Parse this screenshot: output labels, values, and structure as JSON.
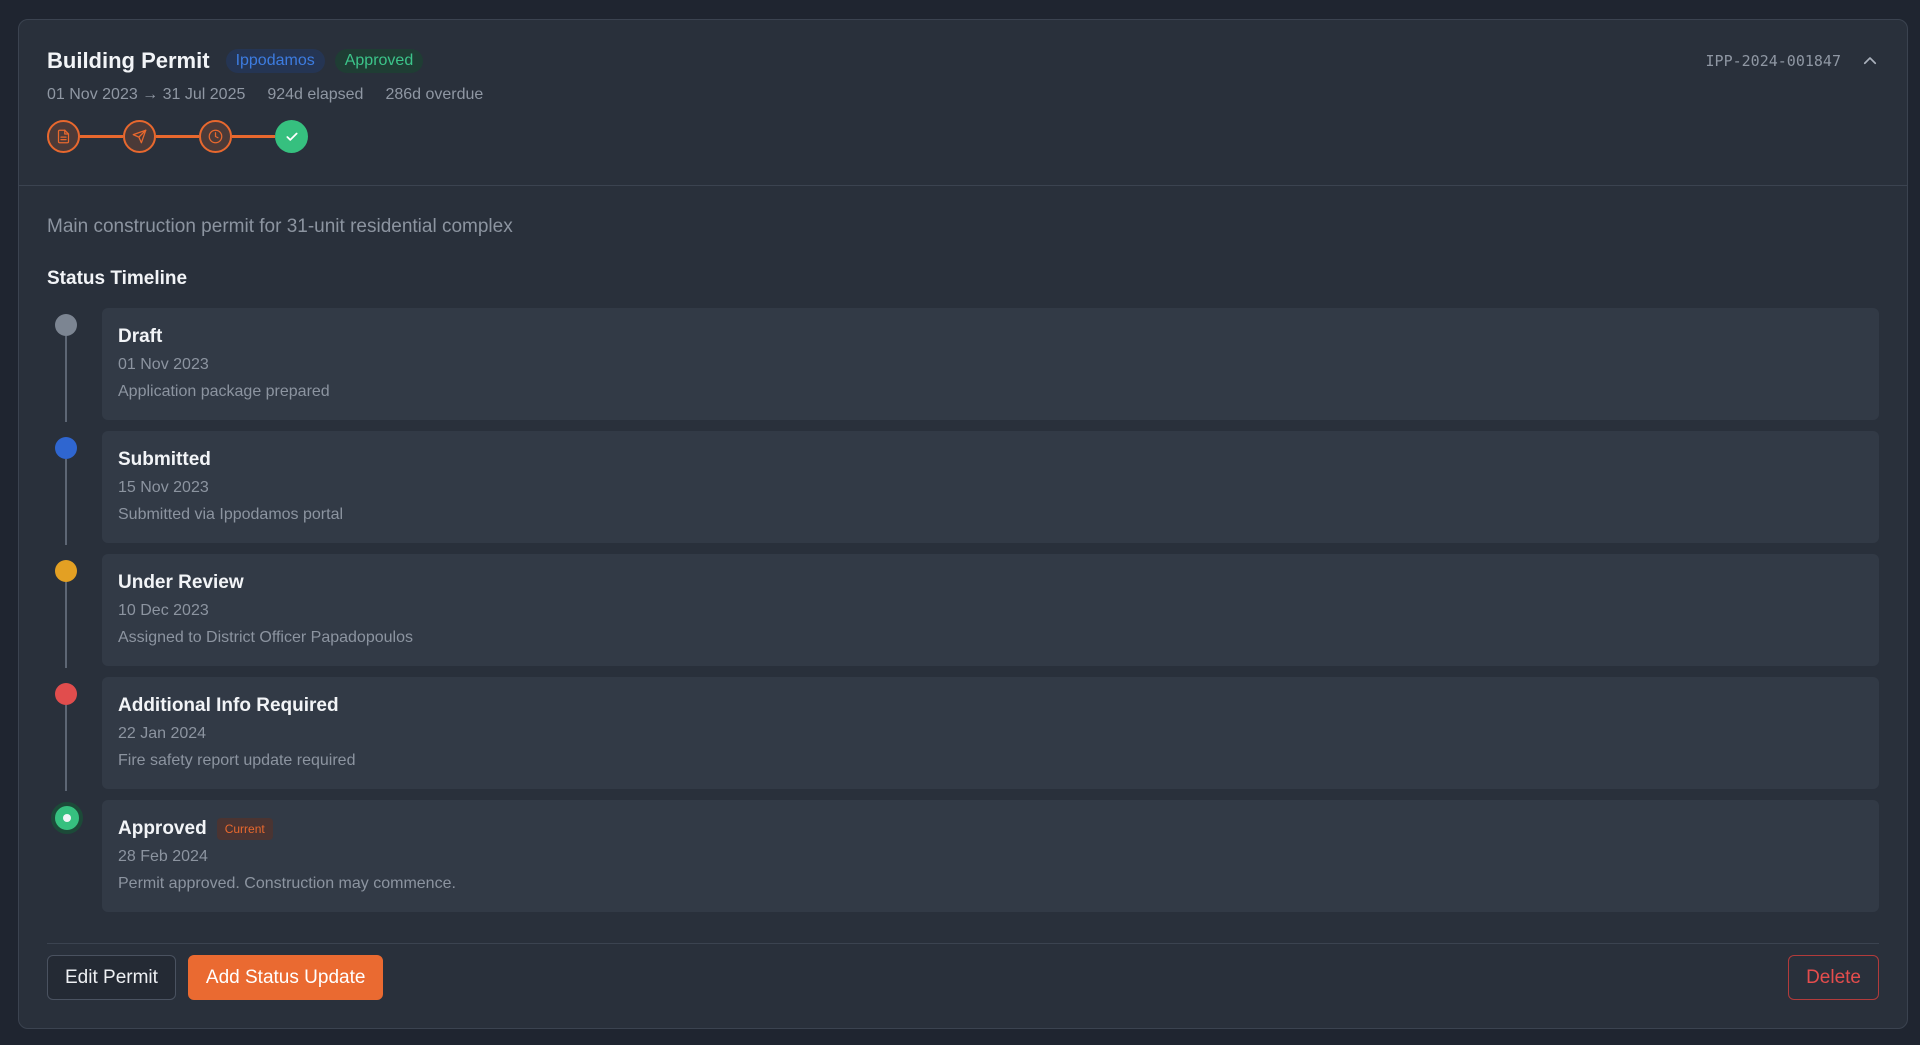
{
  "permit": {
    "title": "Building Permit",
    "authority_badge": "Ippodamos",
    "status_badge": "Approved",
    "date_range": "01 Nov 2023 → 31 Jul 2025",
    "elapsed": "924d elapsed",
    "overdue": "286d overdue",
    "reference": "IPP-2024-001847",
    "description": "Main construction permit for 31-unit residential complex"
  },
  "progress_steps": [
    {
      "icon": "document-icon",
      "state": "done"
    },
    {
      "icon": "send-icon",
      "state": "done"
    },
    {
      "icon": "clock-icon",
      "state": "done"
    },
    {
      "icon": "check-icon",
      "state": "current"
    }
  ],
  "timeline": {
    "section_title": "Status Timeline",
    "current_label": "Current",
    "items": [
      {
        "status": "Draft",
        "date": "01 Nov 2023",
        "note": "Application package prepared",
        "color": "#7c8592"
      },
      {
        "status": "Submitted",
        "date": "15 Nov 2023",
        "note": "Submitted via Ippodamos portal",
        "color": "#2f66d0"
      },
      {
        "status": "Under Review",
        "date": "10 Dec 2023",
        "note": "Assigned to District Officer Papadopoulos",
        "color": "#e3a023"
      },
      {
        "status": "Additional Info Required",
        "date": "22 Jan 2024",
        "note": "Fire safety report update required",
        "color": "#e14d4d"
      },
      {
        "status": "Approved",
        "date": "28 Feb 2024",
        "note": "Permit approved. Construction may commence.",
        "color": "#36c07f"
      }
    ]
  },
  "actions": {
    "edit_label": "Edit Permit",
    "add_update_label": "Add Status Update",
    "delete_label": "Delete"
  },
  "colors": {
    "accent": "#ea6a31",
    "success": "#36c07f",
    "danger": "#e54d4d",
    "info": "#3d7ce0"
  }
}
